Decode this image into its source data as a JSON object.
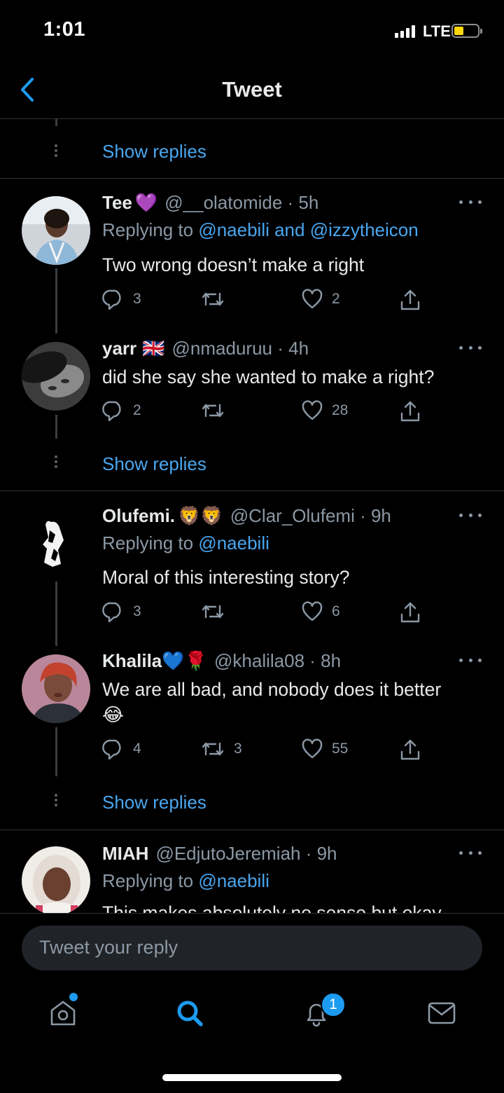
{
  "status": {
    "time": "1:01",
    "network": "LTE"
  },
  "header": {
    "title": "Tweet"
  },
  "show_replies_label": "Show replies",
  "tweets": [
    {
      "name": "Tee",
      "name_emoji": "💜",
      "handle": "@__olatomide · 5h",
      "replying_prefix": "Replying to",
      "replying_to": "@naebili and @izzytheicon",
      "text": "Two wrong doesn’t make a right",
      "replies": "3",
      "retweets": "",
      "likes": "2"
    },
    {
      "name": "yarr",
      "name_emoji": "🇬🇧",
      "handle": "@nmaduruu · 4h",
      "text": "did she say she wanted to make a right?",
      "replies": "2",
      "retweets": "",
      "likes": "28"
    },
    {
      "name": "Olufemi.",
      "name_emoji": "🦁🦁",
      "handle": "@Clar_Olufemi · 9h",
      "replying_prefix": "Replying to",
      "replying_to": "@naebili",
      "text": "Moral of this interesting story?",
      "replies": "3",
      "retweets": "",
      "likes": "6"
    },
    {
      "name": "Khalila",
      "name_emoji": "💙🌹",
      "handle": "@khalila08 · 8h",
      "text": "We are all bad, and nobody does it better",
      "text_emoji": "😂",
      "replies": "4",
      "retweets": "3",
      "likes": "55"
    },
    {
      "name": "MIAH",
      "handle": "@EdjutoJeremiah · 9h",
      "replying_prefix": "Replying to",
      "replying_to": "@naebili",
      "text": "This makes absolutely no sense but okay"
    }
  ],
  "compose": {
    "placeholder": "Tweet your reply"
  },
  "tabbar": {
    "notifications_badge": "1"
  },
  "colors": {
    "accent": "#1d9bf0",
    "link": "#4aa6ee",
    "muted": "#8b98a5",
    "background": "#000000"
  },
  "icons": [
    "back-chevron-icon",
    "reply-icon",
    "retweet-icon",
    "like-icon",
    "share-icon",
    "more-icon",
    "home-icon",
    "search-icon",
    "notifications-icon",
    "messages-icon"
  ]
}
